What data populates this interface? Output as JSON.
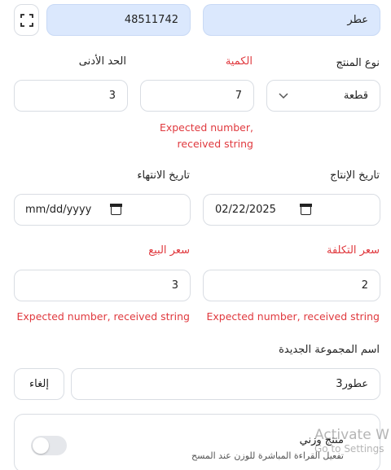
{
  "top": {
    "name_value": "عطر",
    "barcode_value": "48511742"
  },
  "labels": {
    "product_type": "نوع المنتج",
    "quantity": "الكمية",
    "min_limit": "الحد الأدنى",
    "production_date": "تاريخ الإنتاج",
    "expiry_date": "تاريخ الانتهاء",
    "cost_price": "سعر التكلفة",
    "sale_price": "سعر البيع",
    "new_group_name": "اسم المجموعة الجديدة"
  },
  "values": {
    "product_type": "قطعة",
    "quantity": "7",
    "min_limit": "3",
    "production_date": "02/22/2025",
    "expiry_date": "mm/dd/yyyy",
    "cost_price": "2",
    "sale_price": "3",
    "group_name": "عطور3"
  },
  "errors": {
    "quantity_line1": "Expected number,",
    "quantity_line2": "received string",
    "cost_price": "Expected number, received string",
    "sale_price": "Expected number, received string"
  },
  "buttons": {
    "cancel": "إلغاء"
  },
  "weighted": {
    "title": "منتج وزني",
    "description": "تفعيل القراءة المباشرة للوزن عند المسح",
    "enabled": false
  },
  "watermark": {
    "line1": "Activate W",
    "line2": "Go to Settings"
  }
}
